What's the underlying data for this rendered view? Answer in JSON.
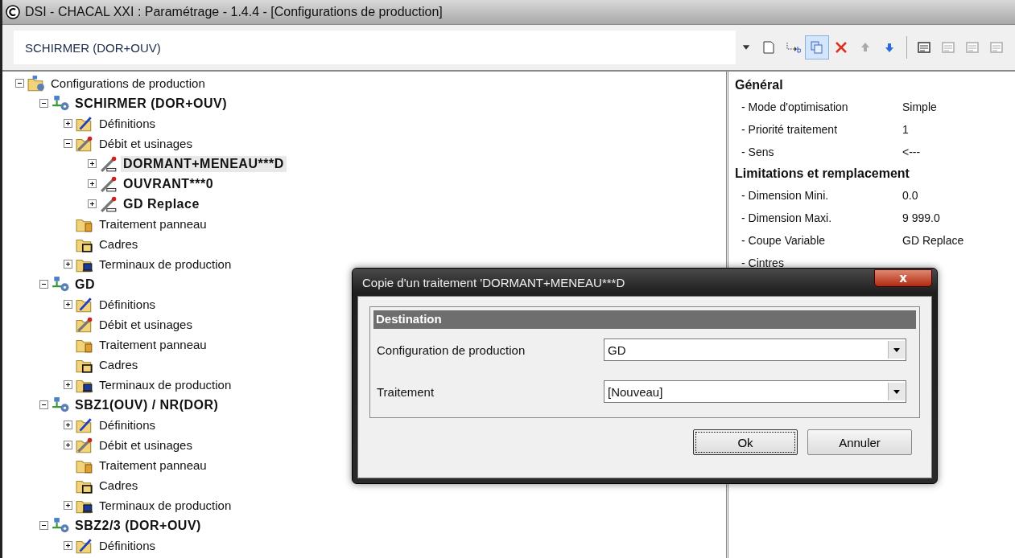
{
  "window": {
    "title": "DSI - CHACAL XXI : Paramétrage - 1.4.4 - [Configurations de production]"
  },
  "selector": {
    "value": "SCHIRMER (DOR+OUV)"
  },
  "toolbar": [
    {
      "kind": "new",
      "disabled": false,
      "selected": false
    },
    {
      "kind": "move",
      "disabled": false,
      "selected": false
    },
    {
      "kind": "copy",
      "disabled": false,
      "selected": true
    },
    {
      "kind": "delete",
      "disabled": false,
      "selected": false
    },
    {
      "kind": "up",
      "disabled": true,
      "selected": false
    },
    {
      "kind": "down",
      "disabled": false,
      "selected": false
    },
    {
      "kind": "properties",
      "disabled": false,
      "selected": false
    },
    {
      "kind": "properties",
      "disabled": true,
      "selected": false
    },
    {
      "kind": "properties",
      "disabled": true,
      "selected": false
    },
    {
      "kind": "properties",
      "disabled": true,
      "selected": false
    }
  ],
  "tree": [
    {
      "label": "Configurations de production",
      "kind": "root",
      "expandable": true,
      "expanded": true,
      "selected": false,
      "children": [
        {
          "label": "SCHIRMER (DOR+OUV)",
          "kind": "config",
          "expandable": true,
          "expanded": true,
          "selected": false,
          "children": [
            {
              "label": "Définitions",
              "kind": "definitions",
              "expandable": true,
              "expanded": false,
              "selected": false
            },
            {
              "label": "Débit et usinages",
              "kind": "debit",
              "expandable": true,
              "expanded": true,
              "selected": false,
              "children": [
                {
                  "label": "DORMANT+MENEAU***D",
                  "kind": "treatment",
                  "expandable": true,
                  "expanded": false,
                  "selected": true
                },
                {
                  "label": "OUVRANT***0",
                  "kind": "treatment",
                  "expandable": true,
                  "expanded": false,
                  "selected": false
                },
                {
                  "label": "GD Replace",
                  "kind": "treatment",
                  "expandable": true,
                  "expanded": false,
                  "selected": false
                }
              ]
            },
            {
              "label": "Traitement panneau",
              "kind": "panel",
              "expandable": false,
              "selected": false
            },
            {
              "label": "Cadres",
              "kind": "frames",
              "expandable": false,
              "selected": false
            },
            {
              "label": "Terminaux de production",
              "kind": "terminals",
              "expandable": true,
              "expanded": false,
              "selected": false
            }
          ]
        },
        {
          "label": "GD",
          "kind": "config",
          "expandable": true,
          "expanded": true,
          "selected": false,
          "children": [
            {
              "label": "Définitions",
              "kind": "definitions",
              "expandable": true,
              "expanded": false,
              "selected": false
            },
            {
              "label": "Débit et usinages",
              "kind": "debit",
              "expandable": false,
              "selected": false
            },
            {
              "label": "Traitement panneau",
              "kind": "panel",
              "expandable": false,
              "selected": false
            },
            {
              "label": "Cadres",
              "kind": "frames",
              "expandable": false,
              "selected": false
            },
            {
              "label": "Terminaux de production",
              "kind": "terminals",
              "expandable": true,
              "expanded": false,
              "selected": false
            }
          ]
        },
        {
          "label": "SBZ1(OUV) / NR(DOR)",
          "kind": "config",
          "expandable": true,
          "expanded": true,
          "selected": false,
          "children": [
            {
              "label": "Définitions",
              "kind": "definitions",
              "expandable": true,
              "expanded": false,
              "selected": false
            },
            {
              "label": "Débit et usinages",
              "kind": "debit",
              "expandable": true,
              "expanded": false,
              "selected": false
            },
            {
              "label": "Traitement panneau",
              "kind": "panel",
              "expandable": false,
              "selected": false
            },
            {
              "label": "Cadres",
              "kind": "frames",
              "expandable": false,
              "selected": false
            },
            {
              "label": "Terminaux de production",
              "kind": "terminals",
              "expandable": true,
              "expanded": false,
              "selected": false
            }
          ]
        },
        {
          "label": "SBZ2/3 (DOR+OUV)",
          "kind": "config",
          "expandable": true,
          "expanded": true,
          "selected": false,
          "children": [
            {
              "label": "Définitions",
              "kind": "definitions",
              "expandable": true,
              "expanded": false,
              "selected": false
            }
          ]
        }
      ]
    }
  ],
  "properties": [
    {
      "title": "Général",
      "items": [
        {
          "label": "- Mode d'optimisation",
          "value": "Simple"
        },
        {
          "label": "- Priorité traitement",
          "value": "1"
        },
        {
          "label": "- Sens",
          "value": "<---"
        }
      ]
    },
    {
      "title": "Limitations et remplacement",
      "items": [
        {
          "label": "- Dimension Mini.",
          "value": "0.0"
        },
        {
          "label": "- Dimension Maxi.",
          "value": "9 999.0"
        },
        {
          "label": "- Coupe Variable",
          "value": "GD Replace"
        },
        {
          "label": "- Cintres"
        }
      ]
    }
  ],
  "dialog": {
    "title": "Copie d'un traitement 'DORMANT+MENEAU***D",
    "close": "x",
    "group": "Destination",
    "fields": [
      {
        "label": "Configuration de production",
        "value": "GD"
      },
      {
        "label": "Traitement",
        "value": "[Nouveau]"
      }
    ],
    "buttons": [
      {
        "label": "Ok",
        "focused": true
      },
      {
        "label": "Annuler",
        "focused": false
      }
    ]
  }
}
